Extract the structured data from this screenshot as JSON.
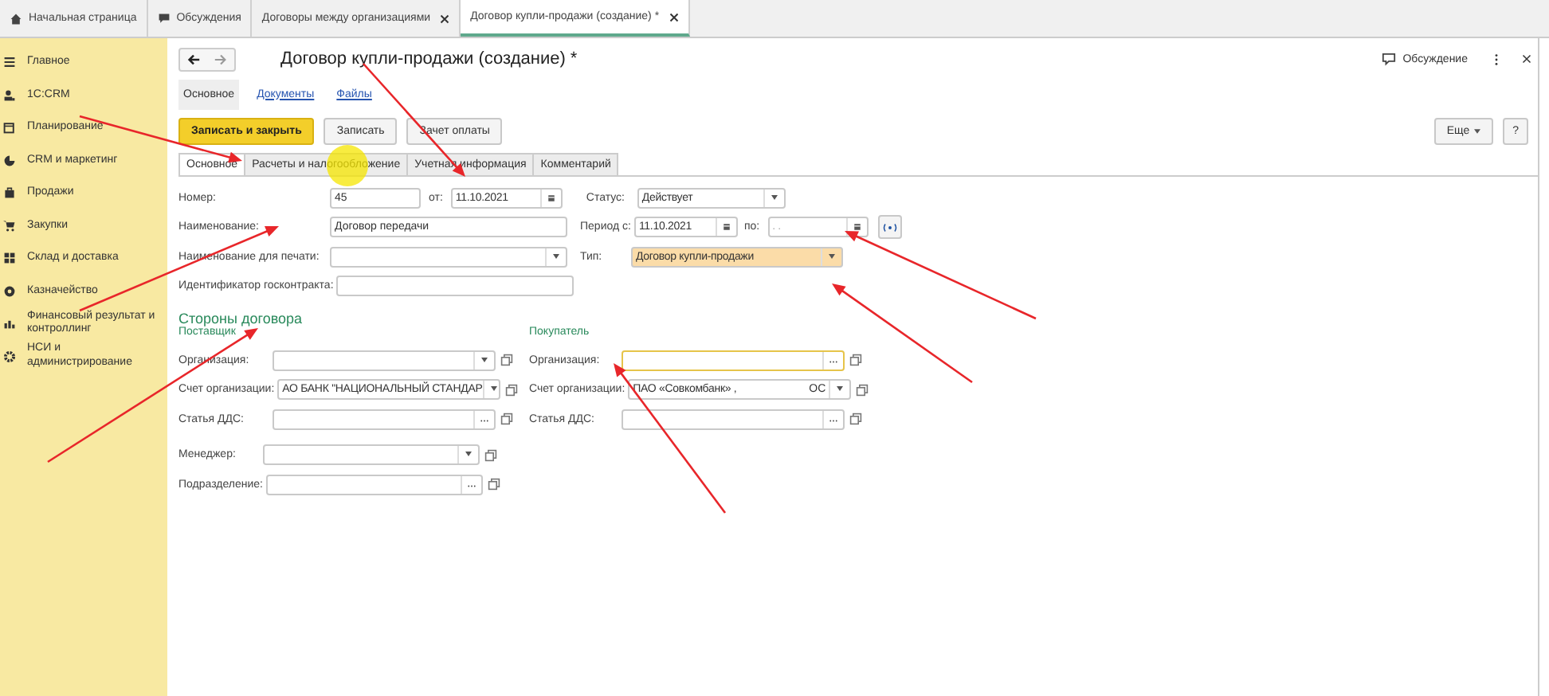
{
  "tabs": [
    {
      "label": "Начальная страница",
      "selected": false,
      "closable": false
    },
    {
      "label": "Обсуждения",
      "selected": false,
      "closable": false
    },
    {
      "label": "Договоры между организациями",
      "selected": false,
      "closable": true
    },
    {
      "label": "Договор купли-продажи (создание) *",
      "selected": true,
      "closable": true
    }
  ],
  "sidebar": {
    "items": [
      {
        "label": "Главное"
      },
      {
        "label": "1С:CRM"
      },
      {
        "label": "Планирование"
      },
      {
        "label": "CRM и маркетинг"
      },
      {
        "label": "Продажи"
      },
      {
        "label": "Закупки"
      },
      {
        "label": "Склад и доставка"
      },
      {
        "label": "Казначейство"
      },
      {
        "label": "Финансовый результат и контроллинг"
      },
      {
        "label": "НСИ и администрирование"
      }
    ]
  },
  "form": {
    "title": "Договор купли-продажи (создание) *",
    "discussion": "Обсуждение",
    "sections": [
      {
        "label": "Основное",
        "selected": true
      },
      {
        "label": "Документы",
        "selected": false
      },
      {
        "label": "Файлы",
        "selected": false
      }
    ],
    "buttons": [
      {
        "label": "Записать и закрыть",
        "kind": "primary"
      },
      {
        "label": "Записать",
        "kind": "normal"
      },
      {
        "label": "Зачет оплаты",
        "kind": "normal"
      }
    ],
    "more": "Еще",
    "help": "?",
    "tabs": [
      {
        "label": "Основное",
        "selected": true
      },
      {
        "label": "Расчеты и налогообложение",
        "selected": false
      },
      {
        "label": "Учетная информация",
        "selected": false
      },
      {
        "label": "Комментарий",
        "selected": false
      }
    ],
    "number": {
      "label": "Номер:",
      "value": "45"
    },
    "date": {
      "label": "от:",
      "value": "11.10.2021"
    },
    "status": {
      "label": "Статус:",
      "value": "Действует"
    },
    "name": {
      "label": "Наименование:",
      "value": "Договор передачи"
    },
    "period": {
      "label": "Период с:",
      "from": "11.10.2021",
      "to_label": "по:",
      "to": ". ."
    },
    "print_name": {
      "label": "Наименование для печати:"
    },
    "type": {
      "label": "Тип:",
      "value": "Договор купли-продажи",
      "highlighted": true
    },
    "gov_id": {
      "label": "Идентификатор госконтракта:"
    },
    "parties": {
      "title": "Стороны договора",
      "supplier": {
        "title": "Поставщик",
        "fields": [
          {
            "label": "Организация:",
            "kind": "dropdown",
            "focused": false
          },
          {
            "label": "Счет организации:",
            "value": "АО БАНК \"НАЦИОНАЛЬНЫЙ СТАНДАР",
            "kind": "dropdown",
            "focused": false
          },
          {
            "label": "Статья ДДС:",
            "kind": "choose",
            "focused": false
          }
        ]
      },
      "buyer": {
        "title": "Покупатель",
        "fields": [
          {
            "label": "Организация:",
            "kind": "choose",
            "focused": true
          },
          {
            "label": "Счет организации:",
            "value": "ПАО «Совкомбанк» ,",
            "value_end": "ОС",
            "kind": "dropdown",
            "focused": false
          },
          {
            "label": "Статья ДДС:",
            "kind": "choose",
            "focused": false
          }
        ]
      },
      "extra": [
        {
          "label": "Менеджер:",
          "kind": "dropdown",
          "focused": false
        },
        {
          "label": "Подразделение:",
          "kind": "choose",
          "focused": false
        }
      ]
    }
  },
  "overlay": {
    "cursor_highlight": true,
    "arrows": [
      {
        "kind": "arrow"
      },
      {
        "kind": "arrow"
      },
      {
        "kind": "arrow"
      },
      {
        "kind": "arrow"
      },
      {
        "kind": "arrow"
      },
      {
        "kind": "arrow"
      },
      {
        "kind": "arrow"
      }
    ]
  }
}
